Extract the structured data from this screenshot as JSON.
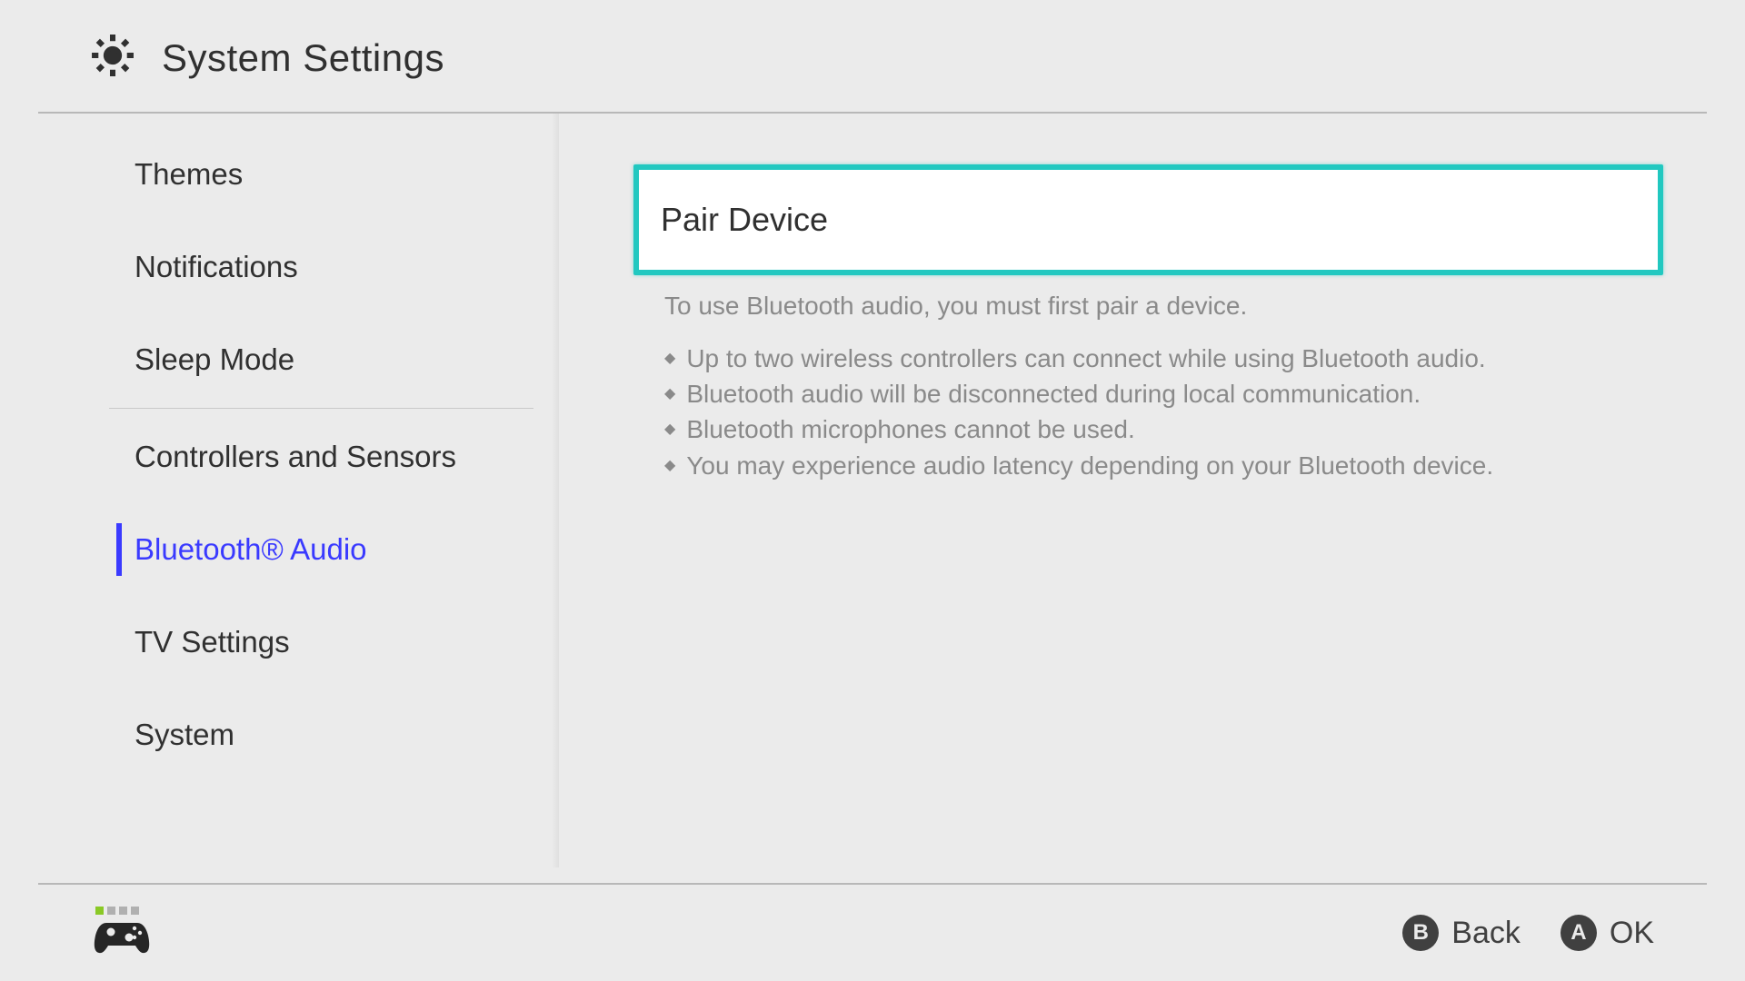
{
  "header": {
    "title": "System Settings"
  },
  "sidebar": {
    "items": [
      {
        "label": "Themes",
        "selected": false
      },
      {
        "label": "Notifications",
        "selected": false
      },
      {
        "label": "Sleep Mode",
        "selected": false
      },
      {
        "label": "Controllers and Sensors",
        "selected": false
      },
      {
        "label": "Bluetooth® Audio",
        "selected": true
      },
      {
        "label": "TV Settings",
        "selected": false
      },
      {
        "label": "System",
        "selected": false
      }
    ]
  },
  "content": {
    "pair_button_label": "Pair Device",
    "description": "To use Bluetooth audio, you must first pair a device.",
    "bullets": [
      "Up to two wireless controllers can connect while using Bluetooth audio.",
      "Bluetooth audio will be disconnected during local communication.",
      "Bluetooth microphones cannot be used.",
      "You may experience audio latency depending on your Bluetooth device."
    ]
  },
  "footer": {
    "back_button": {
      "letter": "B",
      "label": "Back"
    },
    "ok_button": {
      "letter": "A",
      "label": "OK"
    }
  }
}
